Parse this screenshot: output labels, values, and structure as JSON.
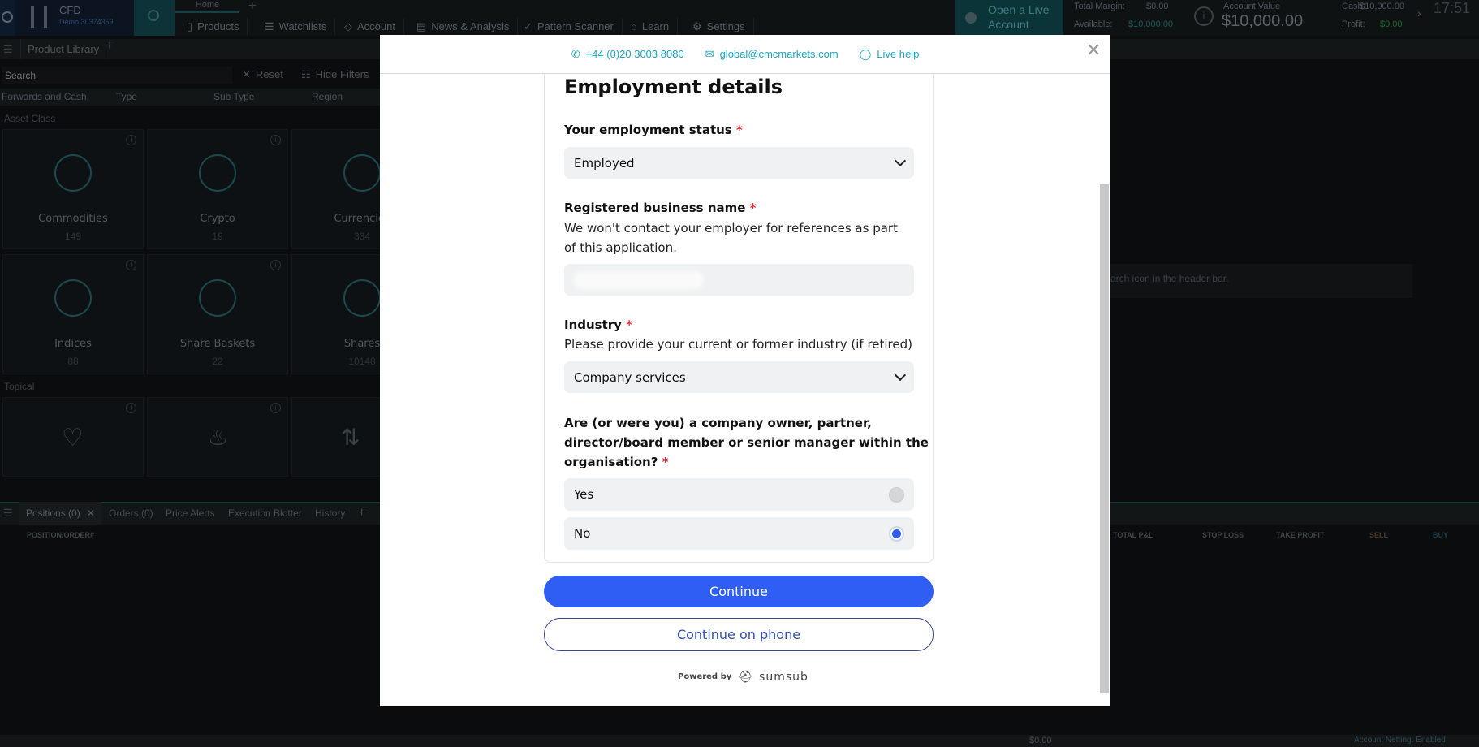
{
  "header": {
    "product": "CFD",
    "account_id": "Demo 30374359",
    "tabs": [
      {
        "label": "Home"
      }
    ],
    "nav": [
      {
        "label": "Products"
      },
      {
        "label": "Watchlists"
      },
      {
        "label": "Account"
      },
      {
        "label": "News & Analysis"
      },
      {
        "label": "Pattern Scanner"
      },
      {
        "label": "Learn"
      },
      {
        "label": "Settings"
      }
    ],
    "live_account": "Open a Live Account",
    "total_margin_label": "Total Margin:",
    "total_margin": "$0.00",
    "available_label": "Available:",
    "available": "$10,000.00",
    "account_value_label": "Account Value",
    "account_value": "$10,000.00",
    "cash_label": "Cash:",
    "cash": "$10,000.00",
    "profit_label": "Profit:",
    "profit": "$0.00",
    "time": "17:51"
  },
  "library": {
    "title": "Product Library",
    "search_placeholder": "Search",
    "reset": "Reset",
    "hide_filters": "Hide Filters",
    "filters": [
      "Forwards and Cash",
      "Type",
      "Sub Type",
      "Region"
    ],
    "asset_class": "Asset Class",
    "tiles": [
      {
        "label": "Commodities",
        "count": "149"
      },
      {
        "label": "Crypto",
        "count": "19"
      },
      {
        "label": "Currencies",
        "count": "334"
      },
      {
        "label": "Indices",
        "count": "88"
      },
      {
        "label": "Share Baskets",
        "count": "22"
      },
      {
        "label": "Shares",
        "count": "10148"
      }
    ],
    "topical": "Topical"
  },
  "right_panel": {
    "hint": "arch icon in the header bar."
  },
  "positions": {
    "tabs": [
      "Positions (0)",
      "Orders (0)",
      "Price Alerts",
      "Execution Blotter",
      "History"
    ],
    "columns": [
      "POSITION/ORDER#",
      "TOTAL P&L",
      "STOP LOSS",
      "TAKE PROFIT",
      "SELL",
      "BUY"
    ]
  },
  "status_bar": {
    "total": "$0.00",
    "netting": "Account Netting: Enabled"
  },
  "modal": {
    "phone": "+44 (0)20 3003 8080",
    "email": "global@cmcmarkets.com",
    "live_help": "Live help",
    "title": "Employment details",
    "employment_label": "Your employment status",
    "employment_value": "Employed",
    "business_label": "Registered business name",
    "business_desc_1": "We won't contact your employer for references as part",
    "business_desc_2": "of this application.",
    "industry_label": "Industry",
    "industry_desc": "Please provide your current or former industry (if retired)",
    "industry_value": "Company services",
    "question_1": "Are (or were you) a company owner, partner,",
    "question_2": "director/board member or senior manager within the",
    "question_3": "organisation?",
    "required": "*",
    "options": [
      {
        "label": "Yes",
        "selected": false
      },
      {
        "label": "No",
        "selected": true
      }
    ],
    "continue": "Continue",
    "continue_phone": "Continue on phone",
    "powered_by": "Powered by",
    "brand": "sumsub"
  },
  "colors": {
    "accent": "#2f5ef5",
    "teal": "#1aa6c4",
    "required": "#e0313b"
  }
}
